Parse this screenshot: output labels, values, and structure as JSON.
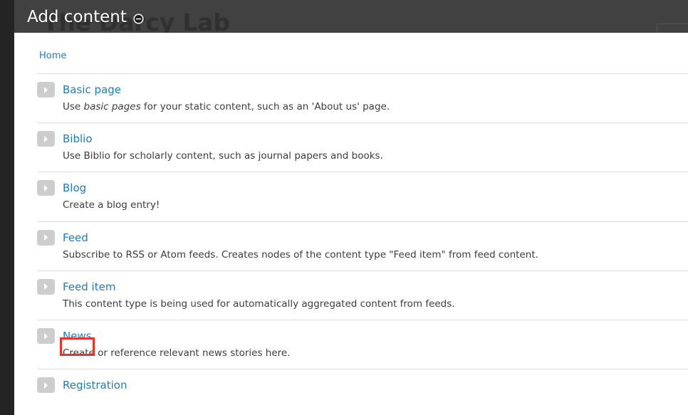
{
  "backdrop": {
    "site_title": "The Darcy Lab",
    "backdrop_color": "#414141",
    "rail_color": "#242424"
  },
  "overlay": {
    "dialog_title": "Add content",
    "collapse_icon": "circle-minus-icon"
  },
  "modal": {
    "breadcrumb": {
      "items": [
        {
          "label": "Home",
          "href": "#"
        }
      ]
    },
    "link_color": "#1f7bc0",
    "highlight_color": "#e8332a",
    "content_types": [
      {
        "icon": "chevron-right-icon",
        "label": "Basic page",
        "desc_before": "Use ",
        "desc_italic": "basic pages",
        "desc_after": " for your static content, such as an 'About us' page.",
        "highlighted": false
      },
      {
        "icon": "chevron-right-icon",
        "label": "Biblio",
        "desc_before": "Use Biblio for scholarly content, such as journal papers and books.",
        "desc_italic": "",
        "desc_after": "",
        "highlighted": false
      },
      {
        "icon": "chevron-right-icon",
        "label": "Blog",
        "desc_before": "Create a blog entry!",
        "desc_italic": "",
        "desc_after": "",
        "highlighted": false
      },
      {
        "icon": "chevron-right-icon",
        "label": "Feed",
        "desc_before": "Subscribe to RSS or Atom feeds. Creates nodes of the content type \"Feed item\" from feed content.",
        "desc_italic": "",
        "desc_after": "",
        "highlighted": false
      },
      {
        "icon": "chevron-right-icon",
        "label": "Feed item",
        "desc_before": "This content type is being used for automatically aggregated content from feeds.",
        "desc_italic": "",
        "desc_after": "",
        "highlighted": false
      },
      {
        "icon": "chevron-right-icon",
        "label": "News",
        "desc_before": "Create or reference relevant news stories here.",
        "desc_italic": "",
        "desc_after": "",
        "highlighted": true
      },
      {
        "icon": "chevron-right-icon",
        "label": "Registration",
        "desc_before": "",
        "desc_italic": "",
        "desc_after": "",
        "highlighted": false
      }
    ]
  }
}
